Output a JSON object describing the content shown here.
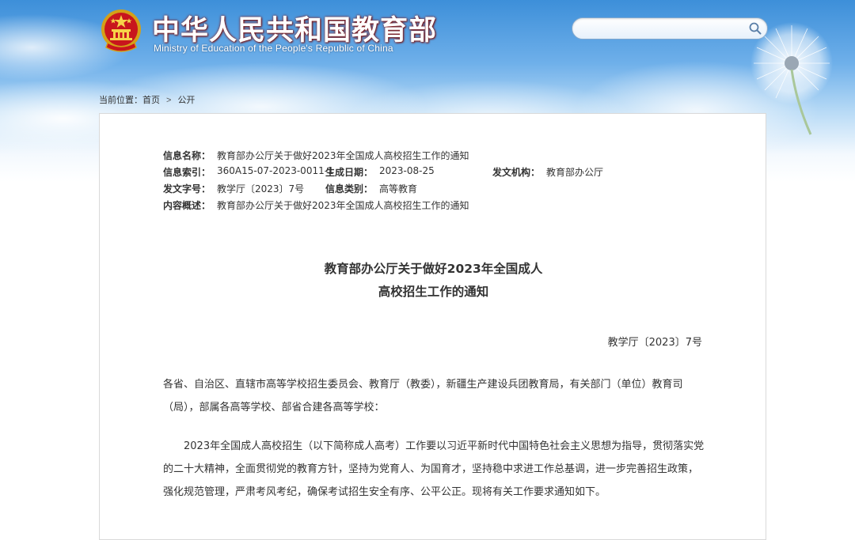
{
  "header": {
    "site_title": "中华人民共和国教育部",
    "site_subtitle": "Ministry of Education of the People's Republic of China",
    "search_placeholder": ""
  },
  "breadcrumb": {
    "prefix": "当前位置：",
    "home": "首页",
    "separator": ">",
    "current": "公开"
  },
  "meta": {
    "info_name_label": "信息名称：",
    "info_name_value": "教育部办公厅关于做好2023年全国成人高校招生工作的通知",
    "info_index_label": "信息索引：",
    "info_index_value": "360A15-07-2023-0011-1",
    "generated_date_label": "生成日期：",
    "generated_date_value": "2023-08-25",
    "issuer_label": "发文机构：",
    "issuer_value": "教育部办公厅",
    "doc_code_label": "发文字号：",
    "doc_code_value": "教学厅〔2023〕7号",
    "info_category_label": "信息类别：",
    "info_category_value": "高等教育",
    "summary_label": "内容概述：",
    "summary_value": "教育部办公厅关于做好2023年全国成人高校招生工作的通知"
  },
  "document": {
    "title_line1": "教育部办公厅关于做好2023年全国成人",
    "title_line2": "高校招生工作的通知",
    "number": "教学厅〔2023〕7号",
    "salutation": "各省、自治区、直辖市高等学校招生委员会、教育厅（教委），新疆生产建设兵团教育局，有关部门（单位）教育司（局），部属各高等学校、部省合建各高等学校：",
    "paragraph1": "2023年全国成人高校招生（以下简称成人高考）工作要以习近平新时代中国特色社会主义思想为指导，贯彻落实党的二十大精神，全面贯彻党的教育方针，坚持为党育人、为国育才，坚持稳中求进工作总基调，进一步完善招生政策，强化规范管理，严肃考风考纪，确保考试招生安全有序、公平公正。现将有关工作要求通知如下。"
  },
  "colors": {
    "sky_top": "#3d8fd9",
    "title_red": "#8a1a1a",
    "text": "#333333",
    "border": "#d9d9d9"
  }
}
